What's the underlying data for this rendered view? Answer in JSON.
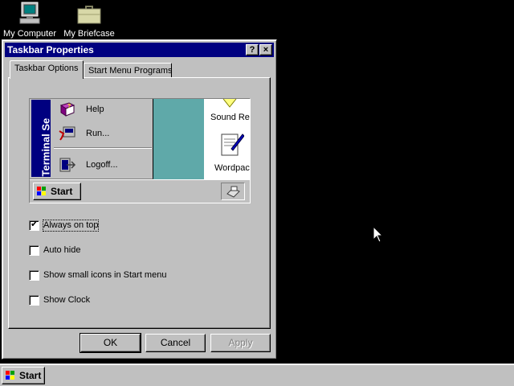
{
  "desktop": {
    "icons": [
      {
        "label": "My Computer",
        "icon": "my-computer-icon"
      },
      {
        "label": "My Briefcase",
        "icon": "briefcase-icon"
      }
    ]
  },
  "dialog": {
    "title": "Taskbar Properties",
    "help_button": "?",
    "close_button": "×",
    "tabs": [
      {
        "label": "Taskbar Options",
        "active": true
      },
      {
        "label": "Start Menu Programs",
        "active": false
      }
    ],
    "preview": {
      "brand_text": "Terminal Se",
      "menu_items": [
        {
          "label": "Help",
          "icon": "help-book-icon"
        },
        {
          "label": "Run...",
          "icon": "run-icon"
        },
        {
          "label": "Logoff...",
          "icon": "logoff-icon"
        }
      ],
      "explorer_items": [
        {
          "label": "Sound Re",
          "icon": "sound-recorder-icon"
        },
        {
          "label": "Wordpac",
          "icon": "wordpad-icon"
        }
      ],
      "start_label": "Start"
    },
    "options": [
      {
        "label": "Always on top",
        "checked": true
      },
      {
        "label": "Auto hide",
        "checked": false
      },
      {
        "label": "Show small icons in Start menu",
        "checked": false
      },
      {
        "label": "Show Clock",
        "checked": false
      }
    ],
    "buttons": {
      "ok": "OK",
      "cancel": "Cancel",
      "apply": "Apply"
    }
  },
  "taskbar": {
    "start_label": "Start"
  },
  "colors": {
    "desktop": "#000000",
    "titlebar": "#000080",
    "face": "#c0c0c0",
    "preview_desktop": "#5fa9a9"
  }
}
